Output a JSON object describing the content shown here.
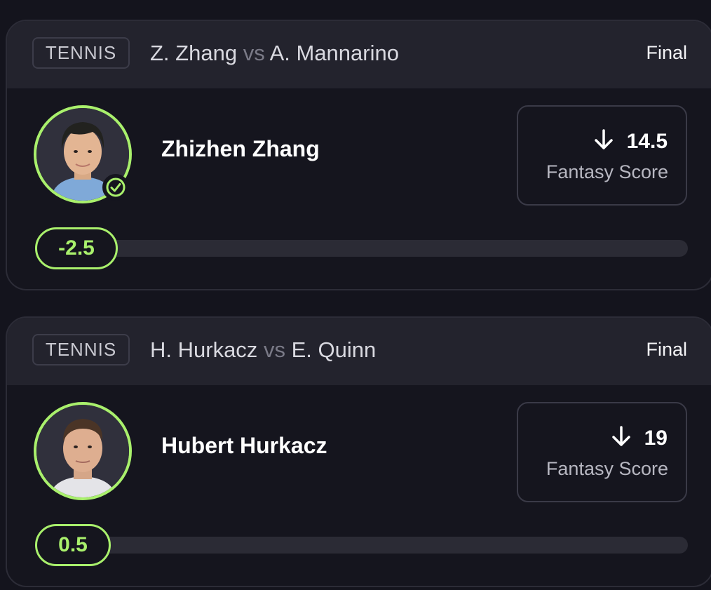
{
  "picks": [
    {
      "sport": "TENNIS",
      "matchup": {
        "team1": "Z. Zhang",
        "vs": "vs",
        "team2": "A. Mannarino"
      },
      "status": "Final",
      "player_name": "Zhizhen Zhang",
      "avatar_icon": "player-photo",
      "checked": true,
      "direction_icon": "arrow-down-icon",
      "score_value": "14.5",
      "score_label": "Fantasy Score",
      "line_value": "-2.5",
      "accent_color": "#a9f06c"
    },
    {
      "sport": "TENNIS",
      "matchup": {
        "team1": "H. Hurkacz",
        "vs": "vs",
        "team2": "E. Quinn"
      },
      "status": "Final",
      "player_name": "Hubert Hurkacz",
      "avatar_icon": "player-photo",
      "checked": false,
      "direction_icon": "arrow-down-icon",
      "score_value": "19",
      "score_label": "Fantasy Score",
      "line_value": "0.5",
      "accent_color": "#a9f06c"
    }
  ]
}
